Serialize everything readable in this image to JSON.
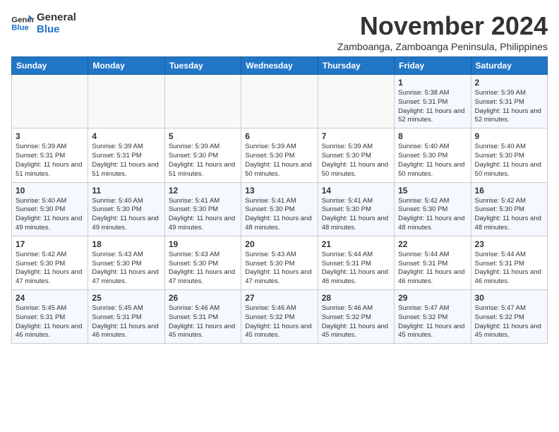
{
  "header": {
    "logo_line1": "General",
    "logo_line2": "Blue",
    "month_title": "November 2024",
    "subtitle": "Zamboanga, Zamboanga Peninsula, Philippines"
  },
  "weekdays": [
    "Sunday",
    "Monday",
    "Tuesday",
    "Wednesday",
    "Thursday",
    "Friday",
    "Saturday"
  ],
  "weeks": [
    [
      {
        "day": "",
        "info": ""
      },
      {
        "day": "",
        "info": ""
      },
      {
        "day": "",
        "info": ""
      },
      {
        "day": "",
        "info": ""
      },
      {
        "day": "",
        "info": ""
      },
      {
        "day": "1",
        "info": "Sunrise: 5:38 AM\nSunset: 5:31 PM\nDaylight: 11 hours and 52 minutes."
      },
      {
        "day": "2",
        "info": "Sunrise: 5:39 AM\nSunset: 5:31 PM\nDaylight: 11 hours and 52 minutes."
      }
    ],
    [
      {
        "day": "3",
        "info": "Sunrise: 5:39 AM\nSunset: 5:31 PM\nDaylight: 11 hours and 51 minutes."
      },
      {
        "day": "4",
        "info": "Sunrise: 5:39 AM\nSunset: 5:31 PM\nDaylight: 11 hours and 51 minutes."
      },
      {
        "day": "5",
        "info": "Sunrise: 5:39 AM\nSunset: 5:30 PM\nDaylight: 11 hours and 51 minutes."
      },
      {
        "day": "6",
        "info": "Sunrise: 5:39 AM\nSunset: 5:30 PM\nDaylight: 11 hours and 50 minutes."
      },
      {
        "day": "7",
        "info": "Sunrise: 5:39 AM\nSunset: 5:30 PM\nDaylight: 11 hours and 50 minutes."
      },
      {
        "day": "8",
        "info": "Sunrise: 5:40 AM\nSunset: 5:30 PM\nDaylight: 11 hours and 50 minutes."
      },
      {
        "day": "9",
        "info": "Sunrise: 5:40 AM\nSunset: 5:30 PM\nDaylight: 11 hours and 50 minutes."
      }
    ],
    [
      {
        "day": "10",
        "info": "Sunrise: 5:40 AM\nSunset: 5:30 PM\nDaylight: 11 hours and 49 minutes."
      },
      {
        "day": "11",
        "info": "Sunrise: 5:40 AM\nSunset: 5:30 PM\nDaylight: 11 hours and 49 minutes."
      },
      {
        "day": "12",
        "info": "Sunrise: 5:41 AM\nSunset: 5:30 PM\nDaylight: 11 hours and 49 minutes."
      },
      {
        "day": "13",
        "info": "Sunrise: 5:41 AM\nSunset: 5:30 PM\nDaylight: 11 hours and 48 minutes."
      },
      {
        "day": "14",
        "info": "Sunrise: 5:41 AM\nSunset: 5:30 PM\nDaylight: 11 hours and 48 minutes."
      },
      {
        "day": "15",
        "info": "Sunrise: 5:42 AM\nSunset: 5:30 PM\nDaylight: 11 hours and 48 minutes."
      },
      {
        "day": "16",
        "info": "Sunrise: 5:42 AM\nSunset: 5:30 PM\nDaylight: 11 hours and 48 minutes."
      }
    ],
    [
      {
        "day": "17",
        "info": "Sunrise: 5:42 AM\nSunset: 5:30 PM\nDaylight: 11 hours and 47 minutes."
      },
      {
        "day": "18",
        "info": "Sunrise: 5:43 AM\nSunset: 5:30 PM\nDaylight: 11 hours and 47 minutes."
      },
      {
        "day": "19",
        "info": "Sunrise: 5:43 AM\nSunset: 5:30 PM\nDaylight: 11 hours and 47 minutes."
      },
      {
        "day": "20",
        "info": "Sunrise: 5:43 AM\nSunset: 5:30 PM\nDaylight: 11 hours and 47 minutes."
      },
      {
        "day": "21",
        "info": "Sunrise: 5:44 AM\nSunset: 5:31 PM\nDaylight: 11 hours and 46 minutes."
      },
      {
        "day": "22",
        "info": "Sunrise: 5:44 AM\nSunset: 5:31 PM\nDaylight: 11 hours and 46 minutes."
      },
      {
        "day": "23",
        "info": "Sunrise: 5:44 AM\nSunset: 5:31 PM\nDaylight: 11 hours and 46 minutes."
      }
    ],
    [
      {
        "day": "24",
        "info": "Sunrise: 5:45 AM\nSunset: 5:31 PM\nDaylight: 11 hours and 46 minutes."
      },
      {
        "day": "25",
        "info": "Sunrise: 5:45 AM\nSunset: 5:31 PM\nDaylight: 11 hours and 46 minutes."
      },
      {
        "day": "26",
        "info": "Sunrise: 5:46 AM\nSunset: 5:31 PM\nDaylight: 11 hours and 45 minutes."
      },
      {
        "day": "27",
        "info": "Sunrise: 5:46 AM\nSunset: 5:32 PM\nDaylight: 11 hours and 45 minutes."
      },
      {
        "day": "28",
        "info": "Sunrise: 5:46 AM\nSunset: 5:32 PM\nDaylight: 11 hours and 45 minutes."
      },
      {
        "day": "29",
        "info": "Sunrise: 5:47 AM\nSunset: 5:32 PM\nDaylight: 11 hours and 45 minutes."
      },
      {
        "day": "30",
        "info": "Sunrise: 5:47 AM\nSunset: 5:32 PM\nDaylight: 11 hours and 45 minutes."
      }
    ]
  ]
}
